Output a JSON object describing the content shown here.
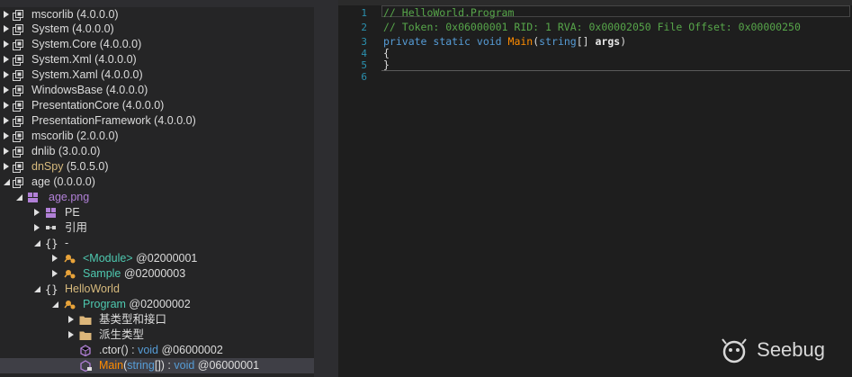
{
  "tree": {
    "items": [
      {
        "label": "mscorlib",
        "suffix": " (4.0.0.0)",
        "color": "#dcdcdc",
        "icon": "assembly-icon"
      },
      {
        "label": "System",
        "suffix": " (4.0.0.0)",
        "color": "#dcdcdc",
        "icon": "assembly-icon"
      },
      {
        "label": "System.Core",
        "suffix": " (4.0.0.0)",
        "color": "#dcdcdc",
        "icon": "assembly-icon"
      },
      {
        "label": "System.Xml",
        "suffix": " (4.0.0.0)",
        "color": "#dcdcdc",
        "icon": "assembly-icon"
      },
      {
        "label": "System.Xaml",
        "suffix": " (4.0.0.0)",
        "color": "#dcdcdc",
        "icon": "assembly-icon"
      },
      {
        "label": "WindowsBase",
        "suffix": " (4.0.0.0)",
        "color": "#dcdcdc",
        "icon": "assembly-icon"
      },
      {
        "label": "PresentationCore",
        "suffix": " (4.0.0.0)",
        "color": "#dcdcdc",
        "icon": "assembly-icon"
      },
      {
        "label": "PresentationFramework",
        "suffix": " (4.0.0.0)",
        "color": "#dcdcdc",
        "icon": "assembly-icon"
      },
      {
        "label": "mscorlib",
        "suffix": " (2.0.0.0)",
        "color": "#dcdcdc",
        "icon": "assembly-icon"
      },
      {
        "label": "dnlib",
        "suffix": " (3.0.0.0)",
        "color": "#dcdcdc",
        "icon": "assembly-icon"
      },
      {
        "label": "dnSpy",
        "suffix": " (5.0.5.0)",
        "color": "#d7ba7d",
        "icon": "assembly-icon"
      },
      {
        "label": "age",
        "suffix": " (0.0.0.0)",
        "color": "#dcdcdc",
        "icon": "assembly-icon"
      },
      {
        "label": "age.png",
        "suffix": "",
        "color": "#b180d7",
        "icon": "module-icon"
      },
      {
        "label": "PE",
        "suffix": "",
        "color": "#dcdcdc",
        "icon": "pe-icon"
      },
      {
        "label": "引用",
        "suffix": "",
        "color": "#dcdcdc",
        "icon": "references-icon"
      },
      {
        "label": "-",
        "suffix": "",
        "color": "#dcdcdc",
        "icon": "namespace-icon"
      },
      {
        "label": "<Module>",
        "suffix": " @02000001",
        "color": "#4ec9b0",
        "icon": "class-icon"
      },
      {
        "label": "Sample",
        "suffix": " @02000003",
        "color": "#4ec9b0",
        "icon": "class-icon"
      },
      {
        "label": "HelloWorld",
        "suffix": "",
        "color": "#d7ba7d",
        "icon": "namespace-icon"
      },
      {
        "label": "Program",
        "suffix": " @02000002",
        "color": "#4ec9b0",
        "icon": "class-icon"
      },
      {
        "label": "基类型和接口",
        "suffix": "",
        "color": "#dcdcdc",
        "icon": "folder-icon"
      },
      {
        "label": "派生类型",
        "suffix": "",
        "color": "#dcdcdc",
        "icon": "folder-icon"
      },
      {
        "label": ".ctor",
        "suffix": "",
        "color": "#dcdcdc",
        "icon": "method-icon"
      },
      {
        "label": "Main",
        "suffix": "",
        "color": "#ff8c00",
        "icon": "method-private-icon"
      }
    ],
    "ctor_sig": {
      "paren": "() : ",
      "ret": "void",
      "token": " @06000002"
    },
    "main_sig": {
      "open": "(",
      "arg": "string",
      "close": "[]) : ",
      "ret": "void",
      "token": " @06000001"
    }
  },
  "editor": {
    "line_numbers": [
      "1",
      "2",
      "3",
      "4",
      "5",
      "6"
    ],
    "line1": "// HelloWorld.Program",
    "line2": "// Token: 0x06000001 RID: 1 RVA: 0x00002050 File Offset: 0x00000250",
    "line3": {
      "kw1": "private",
      "kw2": "static",
      "kw3": "void",
      "method": "Main",
      "p_open": "(",
      "type": "string",
      "rest": "[] ",
      "arg": "args",
      "p_close": ")"
    },
    "line4": "{",
    "line5": "}"
  },
  "watermark": "Seebug"
}
